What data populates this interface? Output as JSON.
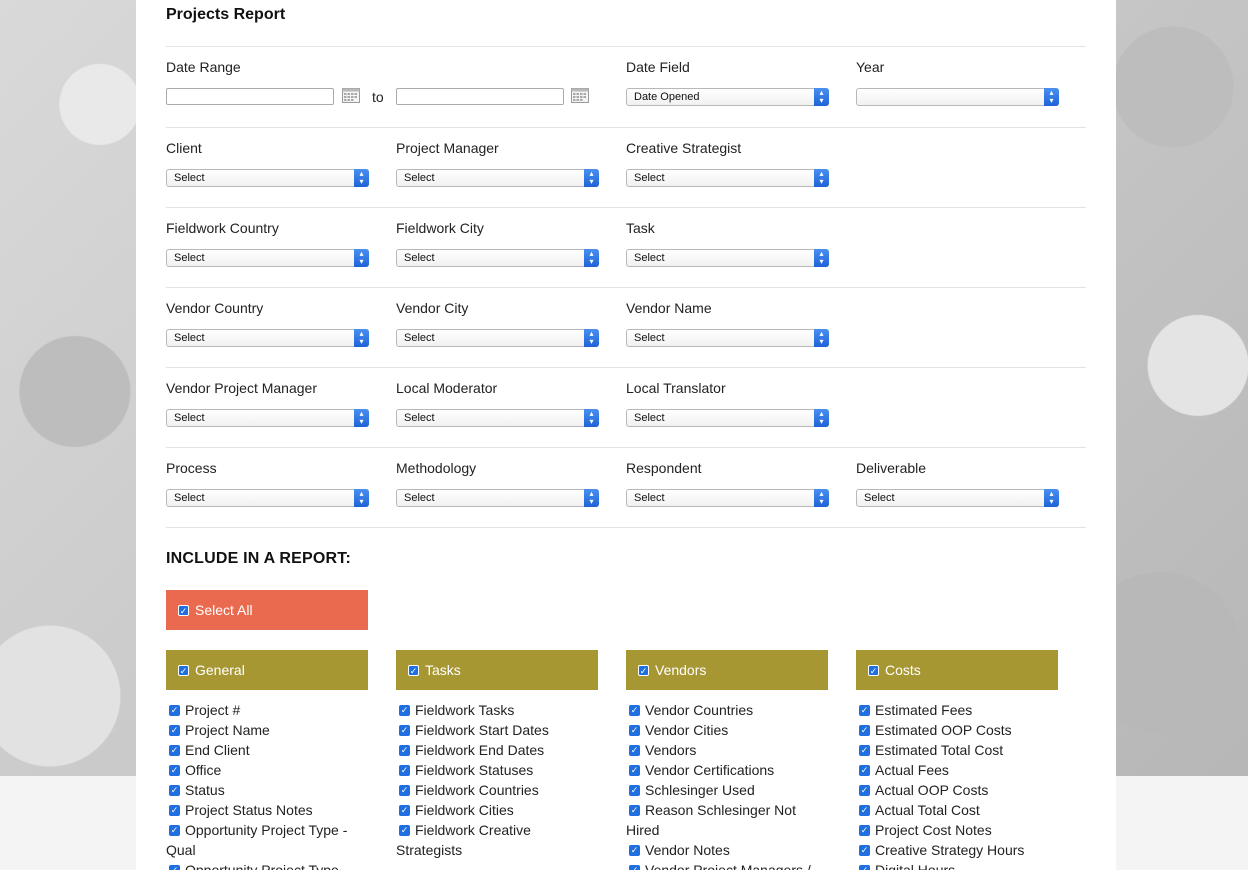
{
  "title": "Projects Report",
  "date_range": {
    "label": "Date Range",
    "from": "",
    "to_label": "to",
    "to": ""
  },
  "date_field": {
    "label": "Date Field",
    "value": "Date Opened"
  },
  "year": {
    "label": "Year",
    "value": ""
  },
  "filters": {
    "client": {
      "label": "Client",
      "value": "Select"
    },
    "project_manager": {
      "label": "Project Manager",
      "value": "Select"
    },
    "creative_strategist": {
      "label": "Creative Strategist",
      "value": "Select"
    },
    "fieldwork_country": {
      "label": "Fieldwork Country",
      "value": "Select"
    },
    "fieldwork_city": {
      "label": "Fieldwork City",
      "value": "Select"
    },
    "task": {
      "label": "Task",
      "value": "Select"
    },
    "vendor_country": {
      "label": "Vendor Country",
      "value": "Select"
    },
    "vendor_city": {
      "label": "Vendor City",
      "value": "Select"
    },
    "vendor_name": {
      "label": "Vendor Name",
      "value": "Select"
    },
    "vendor_project_manager": {
      "label": "Vendor Project Manager",
      "value": "Select"
    },
    "local_moderator": {
      "label": "Local Moderator",
      "value": "Select"
    },
    "local_translator": {
      "label": "Local Translator",
      "value": "Select"
    },
    "process": {
      "label": "Process",
      "value": "Select"
    },
    "methodology": {
      "label": "Methodology",
      "value": "Select"
    },
    "respondent": {
      "label": "Respondent",
      "value": "Select"
    },
    "deliverable": {
      "label": "Deliverable",
      "value": "Select"
    }
  },
  "include": {
    "title": "INCLUDE IN A REPORT:",
    "select_all": "Select All",
    "groups": {
      "general": {
        "label": "General",
        "items": [
          "Project #",
          "Project Name",
          "End Client",
          "Office",
          "Status",
          "Project Status Notes",
          "Opportunity Project Type - Qual",
          "Opportunity Project Type -"
        ]
      },
      "tasks": {
        "label": "Tasks",
        "items": [
          "Fieldwork Tasks",
          "Fieldwork Start Dates",
          "Fieldwork End Dates",
          "Fieldwork Statuses",
          "Fieldwork Countries",
          "Fieldwork Cities",
          "Fieldwork Creative Strategists"
        ]
      },
      "vendors": {
        "label": "Vendors",
        "items": [
          "Vendor Countries",
          "Vendor Cities",
          "Vendors",
          "Vendor Certifications",
          "Schlesinger Used",
          "Reason Schlesinger Not Hired",
          "Vendor Notes",
          "Vendor Project Managers /"
        ]
      },
      "costs": {
        "label": "Costs",
        "items": [
          "Estimated Fees",
          "Estimated OOP Costs",
          "Estimated Total Cost",
          "Actual Fees",
          "Actual OOP Costs",
          "Actual Total Cost",
          "Project Cost Notes",
          "Creative Strategy Hours",
          "Digital Hours"
        ]
      }
    }
  }
}
